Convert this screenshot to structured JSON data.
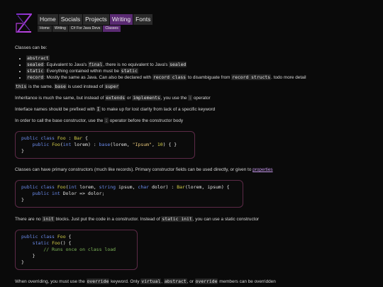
{
  "nav": {
    "items": [
      "Home",
      "Socials",
      "Projects",
      "Writing",
      "Fonts"
    ],
    "active_index": 3
  },
  "breadcrumb": [
    "Home",
    "Writing",
    "C# For Java Devs",
    "Classes"
  ],
  "content": {
    "intro": "Classes can be:",
    "list": [
      {
        "code": "abstract",
        "text": ""
      },
      {
        "code": "sealed",
        "text": ": Equivalent to Java's ",
        "code2": "final",
        "text2": ", there is no equivalent to Java's ",
        "code3": "sealed",
        "text3": ""
      },
      {
        "code": "static",
        "text": ": Everything contained within must be ",
        "code2": "static",
        "text2": ""
      },
      {
        "code": "record",
        "text": ": Mostly the same as Java. Can also be declared with ",
        "code2": "record class",
        "text2": " to disambiguate from ",
        "code3": "record structs",
        "text3": ". todo more detail"
      }
    ],
    "this_line": {
      "code1": "this",
      "mid": " is the same. ",
      "code2": "base",
      "tail": " is used instead of ",
      "code3": "super"
    },
    "inheritance_line": {
      "pre": "Inheritance is much the same, but instead of ",
      "code1": "extends",
      "mid1": " or ",
      "code2": "implements",
      "mid2": ", you use the ",
      "code3": ":",
      "tail": " operator"
    },
    "interface_line": {
      "pre": "Interface names should be prefixed with ",
      "code1": "I",
      "tail": " to make up for lost clarity from lack of a specific keyword"
    },
    "base_ctor_line": {
      "pre": "In order to call the base constructor, use the ",
      "code1": ":",
      "tail": " operator before the constructor body"
    },
    "primary_ctor_line": {
      "pre": "Classes can have primary constructors (much like records). Primary constructor fields can be used directly, or given to ",
      "link": "properties"
    },
    "init_line": {
      "pre": "There are no ",
      "code1": "init",
      "mid": " blocks. Just put the code in a constructor. Instead of ",
      "code2": "static init",
      "tail": ", you can use a static constructor"
    },
    "override_line": {
      "pre": "When overriding, you must use the ",
      "code1": "override",
      "mid1": " keyword. Only ",
      "code2": "virtual",
      "mid2": ", ",
      "code3": "abstract",
      "mid3": ", or ",
      "code4": "override",
      "tail": " members can be overridden"
    }
  },
  "code_blocks": [
    [
      "public class Foo : Bar {",
      "    public Foo(int lorem) : base(lorem, \"Ipsum\", 10) { }",
      "}"
    ],
    [
      "public class Foo(int lorem, string ipsum, char dolor) : Bar(lorem, ipsum) {",
      "    public int Dolor => dolor;",
      "}"
    ],
    [
      "public class Foo {",
      "    static Foo() {",
      "        // Runs once on class load",
      "    }",
      "}"
    ]
  ],
  "colors": {
    "accent": "#5a2a72",
    "link": "#c99af0",
    "code_border": "#5c2a47",
    "keyword": "#6d8ef0",
    "type": "#d8d24a",
    "comment": "#7fb85a"
  },
  "icons": {
    "logo": "hourglass-logo-icon"
  }
}
